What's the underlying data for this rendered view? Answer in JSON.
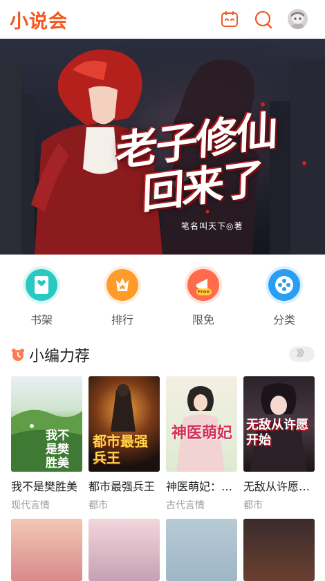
{
  "header": {
    "logo": "小说会",
    "icons": [
      "history-icon",
      "search-icon",
      "avatar"
    ]
  },
  "banner": {
    "title_line1": "老子修仙",
    "title_line2": "回来了",
    "author": "笔名叫天下◎著"
  },
  "quick_nav": [
    {
      "label": "书架",
      "icon": "bookshelf-icon",
      "color": "#25c6c1"
    },
    {
      "label": "排行",
      "icon": "ranking-icon",
      "color": "#ff9a2a"
    },
    {
      "label": "限免",
      "icon": "free-icon",
      "color": "#ff6a4a",
      "badge": "Free"
    },
    {
      "label": "分类",
      "icon": "category-icon",
      "color": "#2a9cf0"
    }
  ],
  "section": {
    "title": "小编力荐",
    "more": "》》"
  },
  "books": [
    {
      "title": "我不是樊胜美",
      "category": "现代言情",
      "cover_text": "我不是樊胜美"
    },
    {
      "title": "都市最强兵王",
      "category": "都市",
      "cover_text": "都市最强兵王"
    },
    {
      "title": "神医萌妃：王爷抱一抱",
      "category": "古代言情",
      "cover_text": "神医萌妃"
    },
    {
      "title": "无敌从许愿开始",
      "category": "都市",
      "cover_text": "无敌从许愿开始"
    }
  ]
}
